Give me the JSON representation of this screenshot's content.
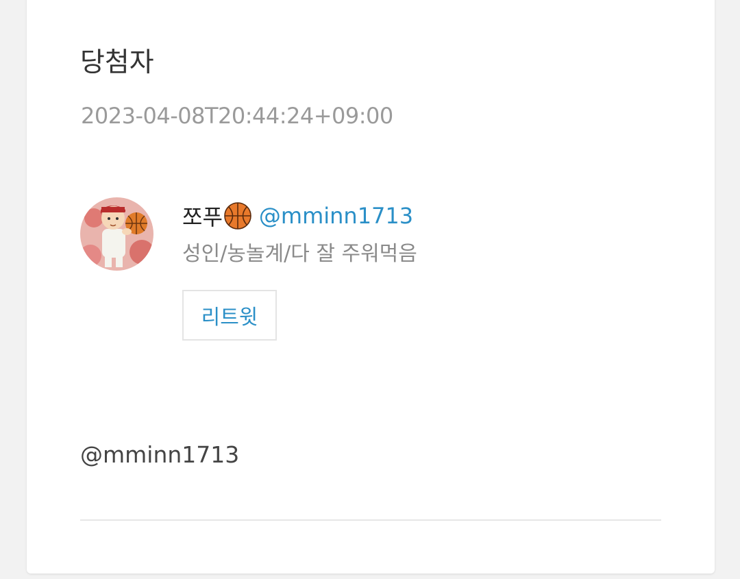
{
  "post": {
    "title": "당첨자",
    "timestamp": "2023-04-08T20:44:24+09:00"
  },
  "tweet": {
    "display_name": "쪼푸",
    "name_emoji": "basketball-icon",
    "handle": "@mminn1713",
    "bio": "성인/농놀계/다 잘 주워먹음",
    "retweet_label": "리트윗"
  },
  "content": {
    "text": "@mminn1713"
  },
  "colors": {
    "link": "#2a8fc7",
    "muted": "#9a9a9a",
    "background": "#f2f2f2",
    "card": "#ffffff"
  }
}
